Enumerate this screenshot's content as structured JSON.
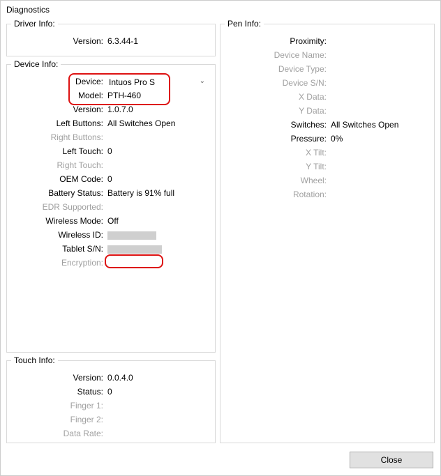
{
  "window": {
    "title": "Diagnostics"
  },
  "sections": {
    "driver": "Driver Info:",
    "device": "Device Info:",
    "touch": "Touch Info:",
    "pen": "Pen Info:"
  },
  "driver": {
    "version_label": "Version:",
    "version": "6.3.44-1"
  },
  "device": {
    "device_label": "Device:",
    "device": "Intuos Pro S",
    "model_label": "Model:",
    "model": "PTH-460",
    "version_label": "Version:",
    "version": "1.0.7.0",
    "left_buttons_label": "Left Buttons:",
    "left_buttons": "All Switches Open",
    "right_buttons_label": "Right Buttons:",
    "right_buttons": "",
    "left_touch_label": "Left Touch:",
    "left_touch": "0",
    "right_touch_label": "Right Touch:",
    "right_touch": "",
    "oem_code_label": "OEM Code:",
    "oem_code": "0",
    "battery_label": "Battery Status:",
    "battery": "Battery is 91% full",
    "edr_label": "EDR Supported:",
    "edr": "",
    "wireless_mode_label": "Wireless Mode:",
    "wireless_mode": "Off",
    "wireless_id_label": "Wireless ID:",
    "tablet_sn_label": "Tablet S/N:",
    "encryption_label": "Encryption:",
    "encryption": ""
  },
  "touch": {
    "version_label": "Version:",
    "version": "0.0.4.0",
    "status_label": "Status:",
    "status": "0",
    "finger1_label": "Finger 1:",
    "finger1": "",
    "finger2_label": "Finger 2:",
    "finger2": "",
    "data_rate_label": "Data Rate:",
    "data_rate": ""
  },
  "pen": {
    "proximity_label": "Proximity:",
    "device_name_label": "Device Name:",
    "device_type_label": "Device Type:",
    "device_sn_label": "Device S/N:",
    "x_data_label": "X Data:",
    "y_data_label": "Y Data:",
    "switches_label": "Switches:",
    "switches": "All Switches Open",
    "pressure_label": "Pressure:",
    "pressure": "0%",
    "x_tilt_label": "X Tilt:",
    "y_tilt_label": "Y Tilt:",
    "wheel_label": "Wheel:",
    "rotation_label": "Rotation:"
  },
  "footer": {
    "close": "Close"
  }
}
